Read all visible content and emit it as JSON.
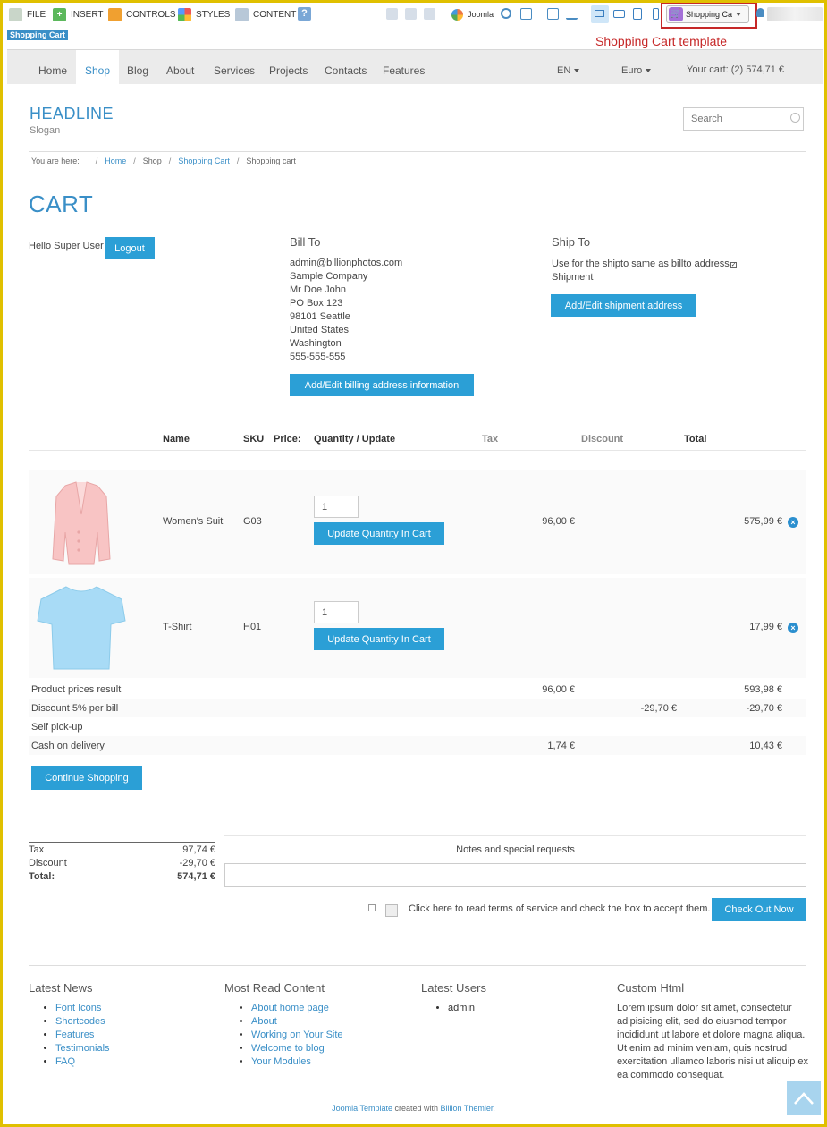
{
  "toolbar": {
    "file": "FILE",
    "insert": "INSERT",
    "controls": "CONTROLS",
    "styles": "STYLES",
    "content": "CONTENT",
    "joomla": "Joomla",
    "template_select": "Shopping Ca",
    "page_badge": "Shopping Cart",
    "template_annotation": "Shopping Cart template"
  },
  "nav": {
    "items": [
      "Home",
      "Shop",
      "Blog",
      "About",
      "Services",
      "Projects",
      "Contacts",
      "Features"
    ],
    "active": "Shop",
    "language": "EN",
    "currency": "Euro",
    "cart_summary": "Your cart: (2) 574,71 €"
  },
  "header": {
    "headline": "HEADLINE",
    "slogan": "Slogan",
    "search_placeholder": "Search"
  },
  "breadcrumb": {
    "prefix": "You are here:",
    "items": [
      "Home",
      "Shop",
      "Shopping Cart",
      "Shopping cart"
    ]
  },
  "cart": {
    "title": "CART",
    "greeting": "Hello Super User",
    "logout": "Logout"
  },
  "bill_to": {
    "heading": "Bill To",
    "lines": [
      "admin@billionphotos.com",
      "Sample Company",
      "Mr Doe John",
      "PO Box 123",
      "98101 Seattle",
      "United States",
      "Washington",
      "555-555-555"
    ],
    "button": "Add/Edit billing address information"
  },
  "ship_to": {
    "heading": "Ship To",
    "same_label": "Use for the shipto same as billto address",
    "shipment": "Shipment",
    "button": "Add/Edit shipment address"
  },
  "table": {
    "headers": [
      "Name",
      "SKU",
      "Price:",
      "Quantity / Update",
      "Tax",
      "Discount",
      "Total"
    ],
    "rows": [
      {
        "name": "Women's Suit",
        "sku": "G03",
        "qty": "1",
        "update": "Update Quantity In Cart",
        "tax": "96,00 €",
        "total": "575,99 €"
      },
      {
        "name": "T-Shirt",
        "sku": "H01",
        "qty": "1",
        "update": "Update Quantity In Cart",
        "tax": "",
        "total": "17,99 €"
      }
    ],
    "summary": [
      {
        "label": "Product prices result",
        "tax": "96,00 €",
        "discount": "",
        "total": "593,98 €"
      },
      {
        "label": "Discount 5% per bill",
        "tax": "",
        "discount": "-29,70 €",
        "total": "-29,70 €"
      },
      {
        "label": "Self pick-up",
        "tax": "",
        "discount": "",
        "total": ""
      },
      {
        "label": "Cash on delivery",
        "tax": "1,74 €",
        "discount": "",
        "total": "10,43 €"
      }
    ],
    "continue": "Continue Shopping"
  },
  "totals": {
    "tax_label": "Tax",
    "tax_value": "97,74 €",
    "discount_label": "Discount",
    "discount_value": "-29,70 €",
    "total_label": "Total:",
    "total_value": "574,71 €"
  },
  "notes": {
    "label": "Notes and special requests",
    "terms": "Click here to read terms of service and check the box to accept them.",
    "checkout": "Check Out Now"
  },
  "footer": {
    "latest_news": {
      "heading": "Latest News",
      "items": [
        "Font Icons",
        "Shortcodes",
        "Features",
        "Testimonials",
        "FAQ"
      ]
    },
    "most_read": {
      "heading": "Most Read Content",
      "items": [
        "About home page",
        "About",
        "Working on Your Site",
        "Welcome to blog",
        "Your Modules"
      ]
    },
    "latest_users": {
      "heading": "Latest Users",
      "items": [
        "admin"
      ]
    },
    "custom_html": {
      "heading": "Custom Html",
      "text": "Lorem ipsum dolor sit amet, consectetur adipisicing elit, sed do eiusmod tempor incididunt ut labore et dolore magna aliqua. Ut enim ad minim veniam, quis nostrud exercitation ullamco laboris nisi ut aliquip ex ea commodo consequat."
    },
    "credit_link1": "Joomla Template",
    "credit_mid": " created with ",
    "credit_link2": "Billion Themler",
    "credit_end": "."
  },
  "colors": {
    "accent": "#3a8fc7",
    "button": "#2b9fd6",
    "annotation": "#c62828"
  }
}
